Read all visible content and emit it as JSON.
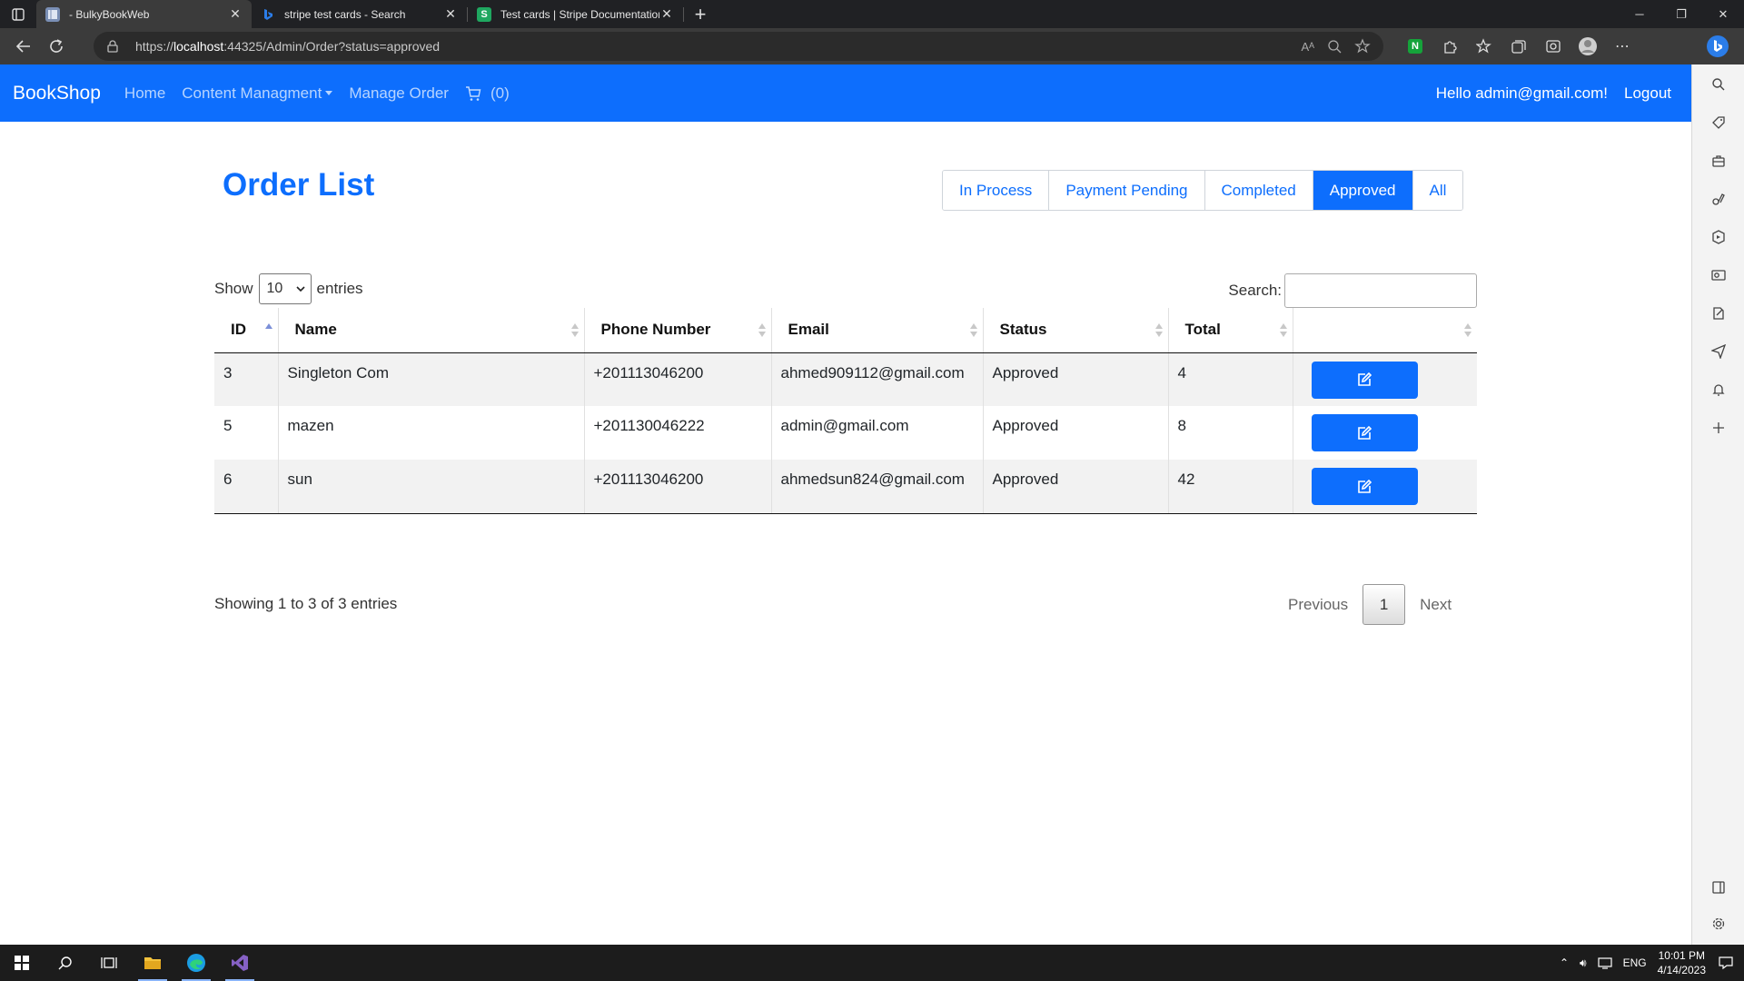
{
  "browser": {
    "tabs": [
      {
        "title": "- BulkyBookWeb",
        "active": true
      },
      {
        "title": "stripe test cards - Search",
        "active": false
      },
      {
        "title": "Test cards | Stripe Documentation",
        "active": false
      }
    ],
    "url_prefix": "https://",
    "url_host": "localhost",
    "url_rest": ":44325/Admin/Order?status=approved"
  },
  "navbar": {
    "brand": "BookShop",
    "links": [
      "Home",
      "Content Managment",
      "Manage Order"
    ],
    "cart_count": "(0)",
    "greeting": "Hello admin@gmail.com!",
    "logout": "Logout"
  },
  "page": {
    "title": "Order List",
    "status_filters": [
      "In Process",
      "Payment Pending",
      "Completed",
      "Approved",
      "All"
    ],
    "active_filter": "Approved"
  },
  "table": {
    "show_label": "Show",
    "entries_label": "entries",
    "page_length": "10",
    "search_label": "Search:",
    "columns": [
      "ID",
      "Name",
      "Phone Number",
      "Email",
      "Status",
      "Total"
    ],
    "rows": [
      {
        "id": "3",
        "name": "Singleton Com",
        "phone": "+201113046200",
        "email": "ahmed909112@gmail.com",
        "status": "Approved",
        "total": "4"
      },
      {
        "id": "5",
        "name": "mazen",
        "phone": "+201130046222",
        "email": "admin@gmail.com",
        "status": "Approved",
        "total": "8"
      },
      {
        "id": "6",
        "name": "sun",
        "phone": "+201113046200",
        "email": "ahmedsun824@gmail.com",
        "status": "Approved",
        "total": "42"
      }
    ],
    "info": "Showing 1 to 3 of 3 entries",
    "pagination": {
      "previous": "Previous",
      "current": "1",
      "next": "Next"
    }
  },
  "taskbar": {
    "language": "ENG",
    "time": "10:01 PM",
    "date": "4/14/2023"
  },
  "colors": {
    "primary": "#0d6efd",
    "browser_dark": "#202124"
  }
}
